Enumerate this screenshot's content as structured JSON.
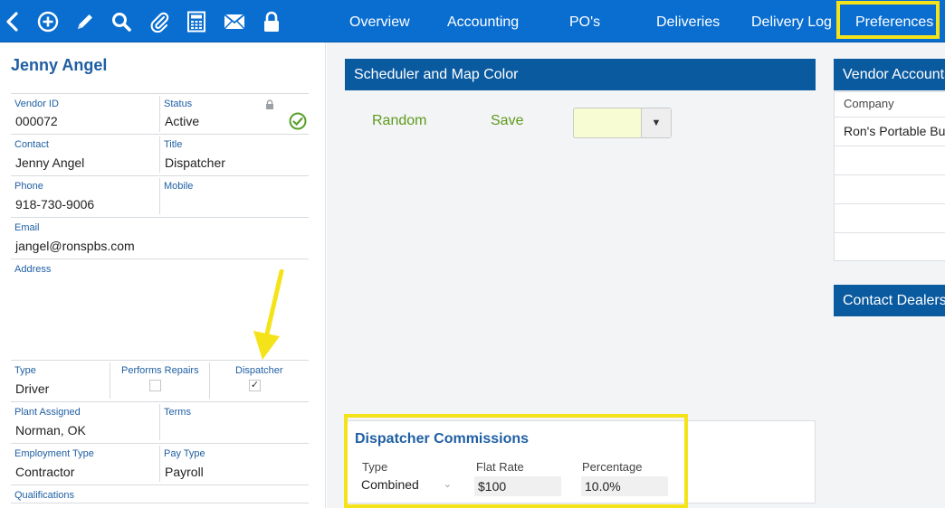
{
  "toolbar": {
    "icons": [
      "back-icon",
      "add-icon",
      "edit-icon",
      "search-icon",
      "attach-icon",
      "calculator-icon",
      "mail-icon",
      "lock-icon"
    ]
  },
  "nav": {
    "tabs": [
      "Overview",
      "Accounting",
      "PO's",
      "Deliveries",
      "Delivery Log",
      "Preferences"
    ],
    "active": "Preferences"
  },
  "vendor": {
    "name": "Jenny Angel",
    "vendor_id_label": "Vendor ID",
    "vendor_id": "000072",
    "status_label": "Status",
    "status": "Active",
    "contact_label": "Contact",
    "contact": "Jenny Angel",
    "title_label": "Title",
    "title": "Dispatcher",
    "phone_label": "Phone",
    "phone": "918-730-9006",
    "mobile_label": "Mobile",
    "mobile": "",
    "email_label": "Email",
    "email": "jangel@ronspbs.com",
    "address_label": "Address",
    "type_label": "Type",
    "type": "Driver",
    "performs_repairs_label": "Performs Repairs",
    "performs_repairs": false,
    "dispatcher_label": "Dispatcher",
    "dispatcher": true,
    "plant_label": "Plant Assigned",
    "plant": "Norman, OK",
    "terms_label": "Terms",
    "terms": "",
    "employment_label": "Employment Type",
    "employment": "Contractor",
    "paytype_label": "Pay Type",
    "paytype": "Payroll",
    "qualifications_label": "Qualifications"
  },
  "scheduler": {
    "title": "Scheduler and Map Color",
    "random_label": "Random",
    "save_label": "Save",
    "selected_color": "#f7fcd2"
  },
  "commissions": {
    "title": "Dispatcher Commissions",
    "type_label": "Type",
    "type_value": "Combined",
    "flat_rate_label": "Flat Rate",
    "flat_rate_value": "$100",
    "percentage_label": "Percentage",
    "percentage_value": "10.0%"
  },
  "vendor_accounts": {
    "title": "Vendor Accounts",
    "column": "Company",
    "rows": [
      "Ron's Portable Bu",
      "",
      "",
      "",
      ""
    ]
  },
  "contact_dealers": {
    "title": "Contact Dealers"
  },
  "colors": {
    "brand_blue": "#0a6ed1",
    "header_blue": "#0a5aa0",
    "label_blue": "#1f5fa3",
    "link_green": "#5e9a1d",
    "highlight": "#f5e31a",
    "status_green": "#5aa02c"
  }
}
